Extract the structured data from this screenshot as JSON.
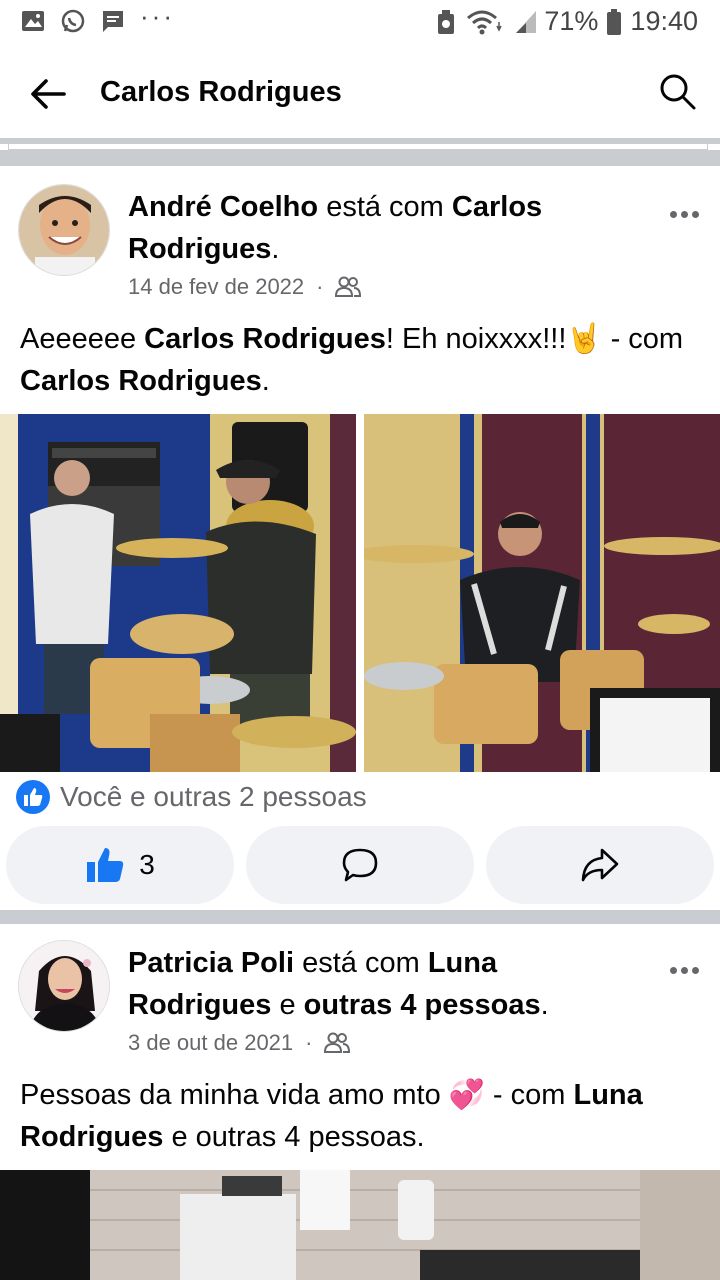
{
  "status_bar": {
    "battery": "71%",
    "time": "19:40",
    "more": "···"
  },
  "header": {
    "title": "Carlos Rodrigues"
  },
  "posts": [
    {
      "author": "André Coelho",
      "with_word": "está com",
      "tagged": "Carlos Rodrigues",
      "tail": ".",
      "date": "14 de fev de 2022",
      "dot": "·",
      "text_pre": "Aeeeeee ",
      "text_bold1": "Carlos Rodrigues",
      "text_mid": "! Eh noixxxx!!!🤘 - com ",
      "text_bold2": "Carlos Rodrigues",
      "text_end": ".",
      "reactions_text": "Você e outras 2 pessoas",
      "like_count": "3"
    },
    {
      "author": "Patricia Poli",
      "with_word": "está com",
      "tagged": "Luna Rodrigues",
      "and_word": "e",
      "others": "outras 4 pessoas",
      "tail": ".",
      "date": "3 de out de 2021",
      "dot": "·",
      "text_pre": "Pessoas da minha vida amo mto 💞 - com ",
      "text_bold1": "Luna Rodrigues",
      "text_end": " e outras 4 pessoas."
    }
  ],
  "colors": {
    "brand": "#1877f2",
    "secondary_text": "#65676b",
    "separator": "#c9ccd1",
    "button_bg": "#f0f2f5"
  },
  "icons": [
    "image-icon",
    "whatsapp-icon",
    "message-icon",
    "recycle-icon",
    "wifi-icon",
    "signal-icon",
    "battery-icon",
    "back-arrow-icon",
    "search-icon",
    "friends-icon",
    "more-icon",
    "like-icon",
    "comment-icon",
    "share-icon"
  ]
}
